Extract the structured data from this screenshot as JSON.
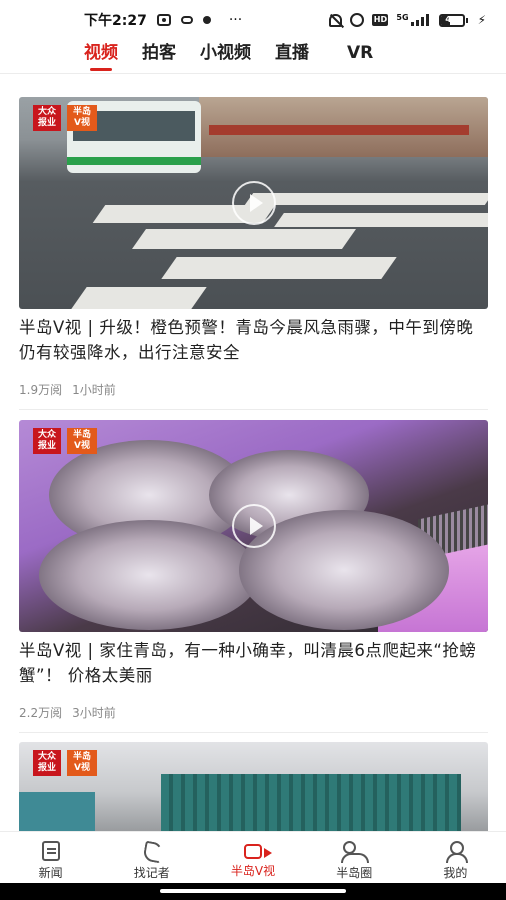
{
  "status_bar": {
    "time": "下午2:27",
    "more": "···",
    "network": "5G",
    "battery_level": "41",
    "battery_fraction": 0.41
  },
  "tabs": [
    {
      "label": "视频",
      "active": true
    },
    {
      "label": "拍客",
      "active": false
    },
    {
      "label": "小视频",
      "active": false
    },
    {
      "label": "直播",
      "active": false
    },
    {
      "label": "VR",
      "active": false
    }
  ],
  "colors": {
    "accent": "#d9231d",
    "text": "#222222",
    "meta": "#888888"
  },
  "feed": [
    {
      "title": "半岛V视 | 升级！橙色预警！青岛今晨风急雨骤，中午到傍晚仍有较强降水，出行注意安全",
      "views": "1.9万阅",
      "time": "1小时前",
      "thumbnail": "rainy-street-crosswalk-bus",
      "logo": [
        "大众报业",
        "半岛V视"
      ]
    },
    {
      "title": "半岛V视 | 家住青岛，有一种小确幸，叫清晨6点爬起来“抢螃蟹”！ 价格太美丽",
      "views": "2.2万阅",
      "time": "3小时前",
      "thumbnail": "baskets-of-crabs-market",
      "logo": [
        "大众报业",
        "半岛V视"
      ]
    },
    {
      "title": "",
      "views": "",
      "time": "",
      "thumbnail": "trucks-on-road",
      "logo": [
        "大众报业",
        "半岛V视"
      ]
    }
  ],
  "bottom_nav": [
    {
      "label": "新闻",
      "icon": "newspaper-icon",
      "active": false
    },
    {
      "label": "找记者",
      "icon": "phone-icon",
      "active": false
    },
    {
      "label": "半岛V视",
      "icon": "video-camera-icon",
      "active": true
    },
    {
      "label": "半岛圈",
      "icon": "group-icon",
      "active": false
    },
    {
      "label": "我的",
      "icon": "person-icon",
      "active": false
    }
  ]
}
